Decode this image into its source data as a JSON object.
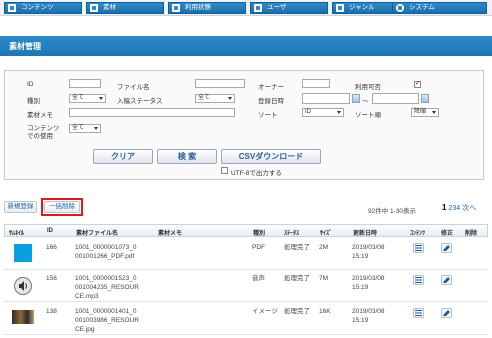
{
  "nav": {
    "items": [
      {
        "label": "コンテンツ",
        "icon": "content-icon"
      },
      {
        "label": "素材",
        "icon": "material-icon"
      },
      {
        "label": "利用状態",
        "icon": "usage-icon"
      },
      {
        "label": "ユーザ",
        "icon": "user-icon"
      },
      {
        "label": "ジャンル",
        "icon": "genre-icon"
      },
      {
        "label": "システム",
        "icon": "gear-icon"
      }
    ]
  },
  "page": {
    "title": "素材管理"
  },
  "search": {
    "id_label": "ID",
    "filename_label": "ファイル名",
    "owner_label": "オーナー",
    "usable_label": "利用可否",
    "usable_checked": "✓",
    "type_label": "種別",
    "type_value": "全て",
    "intake_status_label": "入稿ステータス",
    "intake_status_value": "全て",
    "registered_label": "登録日時",
    "date_separator": "～",
    "memo_label": "素材メモ",
    "sort_label": "ソート",
    "sort_value": "ID",
    "sort_order_label": "ソート順",
    "sort_order_value": "降順",
    "content_use_label_1": "コンテンツ",
    "content_use_label_2": "での使用",
    "content_use_value": "全て",
    "clear_button": "クリア",
    "search_button": "検 索",
    "csv_button": "CSVダウンロード",
    "utf8_label": "UTF-8で出力する"
  },
  "actions": {
    "new_button": "新規登録",
    "bulk_delete_button": "一括削除",
    "count_text": "92件中 1-30表示",
    "pages": [
      "1",
      "2",
      "3",
      "4",
      "次へ"
    ]
  },
  "table": {
    "headers": [
      "ｻﾑﾈｲﾙ",
      "ID",
      "素材ファイル名",
      "素材メモ",
      "種別",
      "ｽﾃｰﾀｽ",
      "ｻｲｽﾞ",
      "更新日時",
      "ｺﾝﾃﾝﾂ",
      "修正",
      "削除"
    ],
    "rows": [
      {
        "id": "166",
        "file1": "1001_0000001073_0",
        "file2": "001001266_PDF.pdf",
        "file3": "",
        "type": "PDF",
        "status": "処理完了",
        "size": "2M",
        "date": "2019/03/08",
        "time": "15:19",
        "thumb": "pdf-thumbnail"
      },
      {
        "id": "156",
        "file1": "1001_0000001523_0",
        "file2": "001004235_RESOUR",
        "file3": "CE.mp3",
        "type": "音声",
        "status": "処理完了",
        "size": "7M",
        "date": "2019/03/08",
        "time": "15:19",
        "thumb": "audio-thumbnail"
      },
      {
        "id": "138",
        "file1": "1001_0000001401_0",
        "file2": "001003986_RESOUR",
        "file3": "CE.jpg",
        "type": "イメージ",
        "status": "処理完了",
        "size": "16K",
        "date": "2019/03/08",
        "time": "15:19",
        "thumb": "image-thumbnail"
      }
    ]
  }
}
